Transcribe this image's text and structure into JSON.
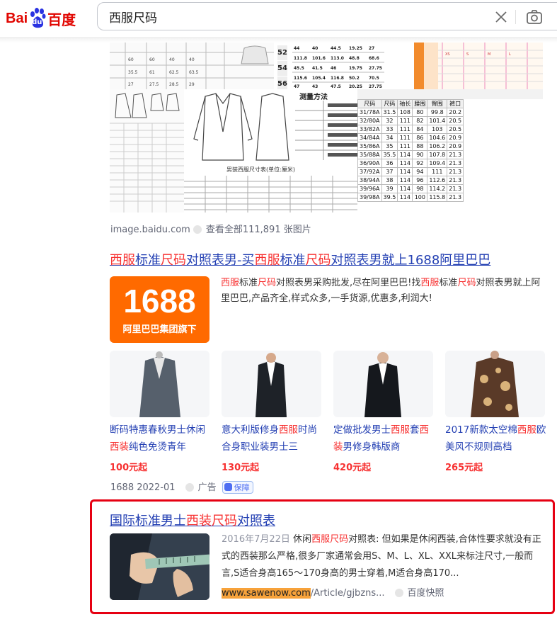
{
  "header": {
    "logo_left": "Bai",
    "logo_du": "du",
    "logo_right": "百度",
    "search_query": "西服尺码",
    "clear_icon": "close-icon",
    "camera_icon": "camera-icon"
  },
  "image_results": {
    "source": "image.baidu.com",
    "view_all": "查看全部111,891 张图片",
    "thumb_sizes": [
      "52",
      "54",
      "56"
    ],
    "size_table_headers": [
      "尺码",
      "尺码",
      "袖长",
      "腰围",
      "臀围",
      "裤口"
    ],
    "size_table_rows": [
      [
        "31/78A",
        "31.5",
        "108",
        "80",
        "99.8",
        "20.2"
      ],
      [
        "32/80A",
        "32",
        "111",
        "82",
        "101.4",
        "20.5"
      ],
      [
        "33/82A",
        "33",
        "111",
        "84",
        "103",
        "20.5"
      ],
      [
        "34/84A",
        "34",
        "111",
        "86",
        "104.6",
        "20.9"
      ],
      [
        "35/86A",
        "35",
        "111",
        "88",
        "106.2",
        "20.9"
      ],
      [
        "35/88A",
        "35.5",
        "114",
        "90",
        "107.8",
        "21.3"
      ],
      [
        "36/90A",
        "36",
        "114",
        "92",
        "109.4",
        "21.3"
      ],
      [
        "37/92A",
        "37",
        "114",
        "94",
        "111",
        "21.3"
      ],
      [
        "38/94A",
        "38",
        "114",
        "96",
        "112.6",
        "21.3"
      ],
      [
        "39/96A",
        "39",
        "114",
        "98",
        "114.2",
        "21.3"
      ],
      [
        "39/98A",
        "39.5",
        "114",
        "100",
        "115.8",
        "21.3"
      ]
    ],
    "measure_title": "测量方法",
    "chart_caption": "男装西服尺寸表(单位:厘米)"
  },
  "result1": {
    "title_parts": [
      {
        "t": "西服",
        "hl": true
      },
      {
        "t": "标准",
        "hl": false
      },
      {
        "t": "尺码",
        "hl": true
      },
      {
        "t": "对照表男-买",
        "hl": false
      },
      {
        "t": "西服",
        "hl": true
      },
      {
        "t": "标准",
        "hl": false
      },
      {
        "t": "尺码",
        "hl": true
      },
      {
        "t": "对照表男就上1688阿里巴巴",
        "hl": false
      }
    ],
    "logo_big": "1688",
    "logo_small": "阿里巴巴集团旗下",
    "desc_parts": [
      {
        "t": "西服",
        "hl": true
      },
      {
        "t": "标准",
        "hl": false
      },
      {
        "t": "尺码",
        "hl": true
      },
      {
        "t": "对照表男采购批发,尽在阿里巴巴!找",
        "hl": false
      },
      {
        "t": "西服",
        "hl": true
      },
      {
        "t": "标准",
        "hl": false
      },
      {
        "t": "尺码",
        "hl": true
      },
      {
        "t": "对照表男就上阿里巴巴,产品齐全,样式众多,一手货源,优惠多,利润大!",
        "hl": false
      }
    ],
    "products": [
      {
        "name_parts": [
          {
            "t": "断码特惠春秋男士休闲",
            "hl": false
          },
          {
            "t": "西装",
            "hl": true
          },
          {
            "t": "纯色免烫青年",
            "hl": false
          }
        ],
        "price": "100元起"
      },
      {
        "name_parts": [
          {
            "t": "意大利版修身",
            "hl": false
          },
          {
            "t": "西服",
            "hl": true
          },
          {
            "t": "时尚合身职业装男士三",
            "hl": false
          }
        ],
        "price": "130元起"
      },
      {
        "name_parts": [
          {
            "t": "定做批发男士",
            "hl": false
          },
          {
            "t": "西服",
            "hl": true
          },
          {
            "t": "套",
            "hl": false
          },
          {
            "t": "西装",
            "hl": true
          },
          {
            "t": "男修身韩版商",
            "hl": false
          }
        ],
        "price": "420元起"
      },
      {
        "name_parts": [
          {
            "t": "2017新款太空棉",
            "hl": false
          },
          {
            "t": "西服",
            "hl": true
          },
          {
            "t": "欧美风不规则高档",
            "hl": false
          }
        ],
        "price": "265元起"
      }
    ],
    "meta_source": "1688",
    "meta_date": "2022-01",
    "meta_ad": "广告",
    "meta_badge": "保障"
  },
  "result2": {
    "title_parts": [
      {
        "t": "国际标准男士",
        "hl": false
      },
      {
        "t": "西装",
        "hl": true
      },
      {
        "t": "尺码",
        "hl": true
      },
      {
        "t": "对照表",
        "hl": false
      }
    ],
    "date": "2016年7月22日",
    "desc_parts": [
      {
        "t": "休闲",
        "hl": false
      },
      {
        "t": "西服",
        "hl": true
      },
      {
        "t": "尺码",
        "hl": true
      },
      {
        "t": "对照表: 但如果是休闲西装,合体性要求就没有正式的西装那么严格,很多厂家通常会用S、M、L、XL、XXL来标注尺寸,一般而言,S适合身高165～170身高的男士穿着,M适合身高170...",
        "hl": false
      }
    ],
    "url_highlight": "www.sawenow.com",
    "url_rest": "/Article/gjbzns...",
    "snapshot": "百度快照"
  },
  "colors": {
    "link": "#2440b3",
    "highlight": "#f73131",
    "annotation_box": "#e60012",
    "logo_1688": "#ff6a00"
  }
}
